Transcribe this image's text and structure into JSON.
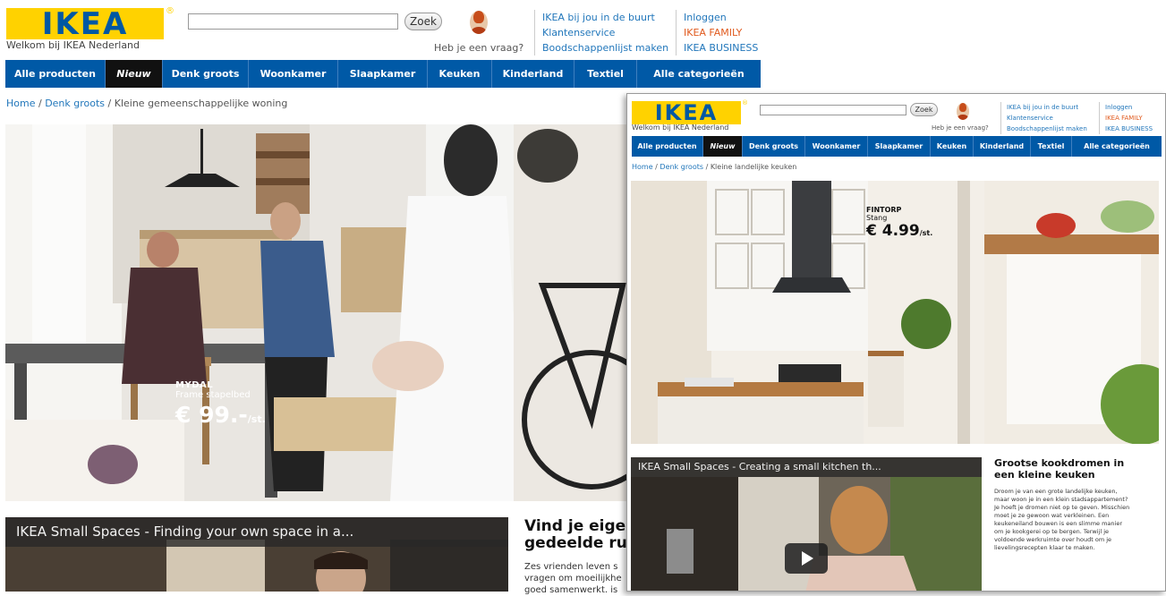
{
  "brand": {
    "logo": "IKEA",
    "reg_mark": "®",
    "welcome": "Welkom bij IKEA Nederland",
    "search_button": "Zoek",
    "question": "Heb je een vraag?"
  },
  "header_links_left": [
    "IKEA bij jou in de buurt",
    "Klantenservice",
    "Boodschappenlijst maken"
  ],
  "header_links_right": [
    {
      "label": "Inloggen",
      "color": "#2277bb"
    },
    {
      "label": "IKEA FAMILY",
      "color": "#e05a1e"
    },
    {
      "label": "IKEA BUSINESS",
      "color": "#2277bb"
    }
  ],
  "nav": [
    "Alle producten",
    "Nieuw",
    "Denk groots",
    "Woonkamer",
    "Slaapkamer",
    "Keuken",
    "Kinderland",
    "Textiel",
    "Alle categorieën"
  ],
  "colors": {
    "accent": "#0059a6",
    "logo_bg": "#ffd200",
    "family": "#e05a1e"
  },
  "back_page": {
    "breadcrumb": [
      "Home",
      "Denk groots",
      "Kleine gemeenschappelijke woning"
    ],
    "product": {
      "name": "MYDAL",
      "desc": "Frame stapelbed",
      "price": "€ 99.-",
      "unit": "/st."
    },
    "video_title": "IKEA Small Spaces - Finding your own space in a...",
    "heading": "Vind je eige gedeelde ru",
    "heading_lines": [
      "Vind je eige",
      "gedeelde ru"
    ],
    "body_lines": [
      "Zes vrienden leven s",
      "vragen om moeilijkhe",
      "goed samenwerkt. is"
    ]
  },
  "front_page": {
    "breadcrumb": [
      "Home",
      "Denk groots",
      "Kleine landelijke keuken"
    ],
    "product": {
      "name": "FINTORP",
      "desc": "Stang",
      "price": "€ 4.99",
      "unit": "/st."
    },
    "video_title": "IKEA Small Spaces - Creating a small kitchen th...",
    "heading_lines": [
      "Grootse kookdromen in",
      "een kleine keuken"
    ],
    "body_lines": [
      "Droom je van een grote landelijke keuken,",
      "maar woon je in een klein stadsappartement?",
      "Je hoeft je dromen niet op te geven. Misschien",
      "moet je ze gewoon wat verkleinen. Een",
      "keukeneiland bouwen is een slimme manier",
      "om je kookgerei op te bergen. Terwijl je",
      "voldoende werkruimte over houdt om je",
      "lievelingsrecepten klaar te maken."
    ]
  }
}
